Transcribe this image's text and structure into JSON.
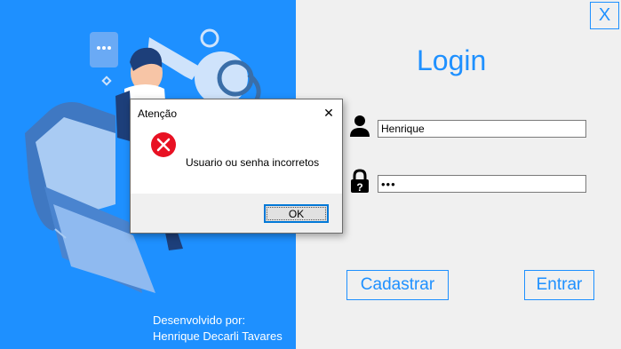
{
  "window": {
    "close_label": "X",
    "title": "Login"
  },
  "form": {
    "username_value": "Henrique",
    "password_value": "•••"
  },
  "buttons": {
    "register_label": "Cadastrar",
    "login_label": "Entrar"
  },
  "credits": {
    "line1": "Desenvolvido por:",
    "line2": "Henrique Decarli Tavares"
  },
  "dialog": {
    "title": "Atenção",
    "close_label": "✕",
    "message": "Usuario ou senha incorretos",
    "ok_label": "OK"
  },
  "colors": {
    "accent": "#1e90ff",
    "error": "#e81123"
  },
  "icons": [
    "user-icon",
    "lock-icon",
    "error-icon",
    "close-icon"
  ]
}
